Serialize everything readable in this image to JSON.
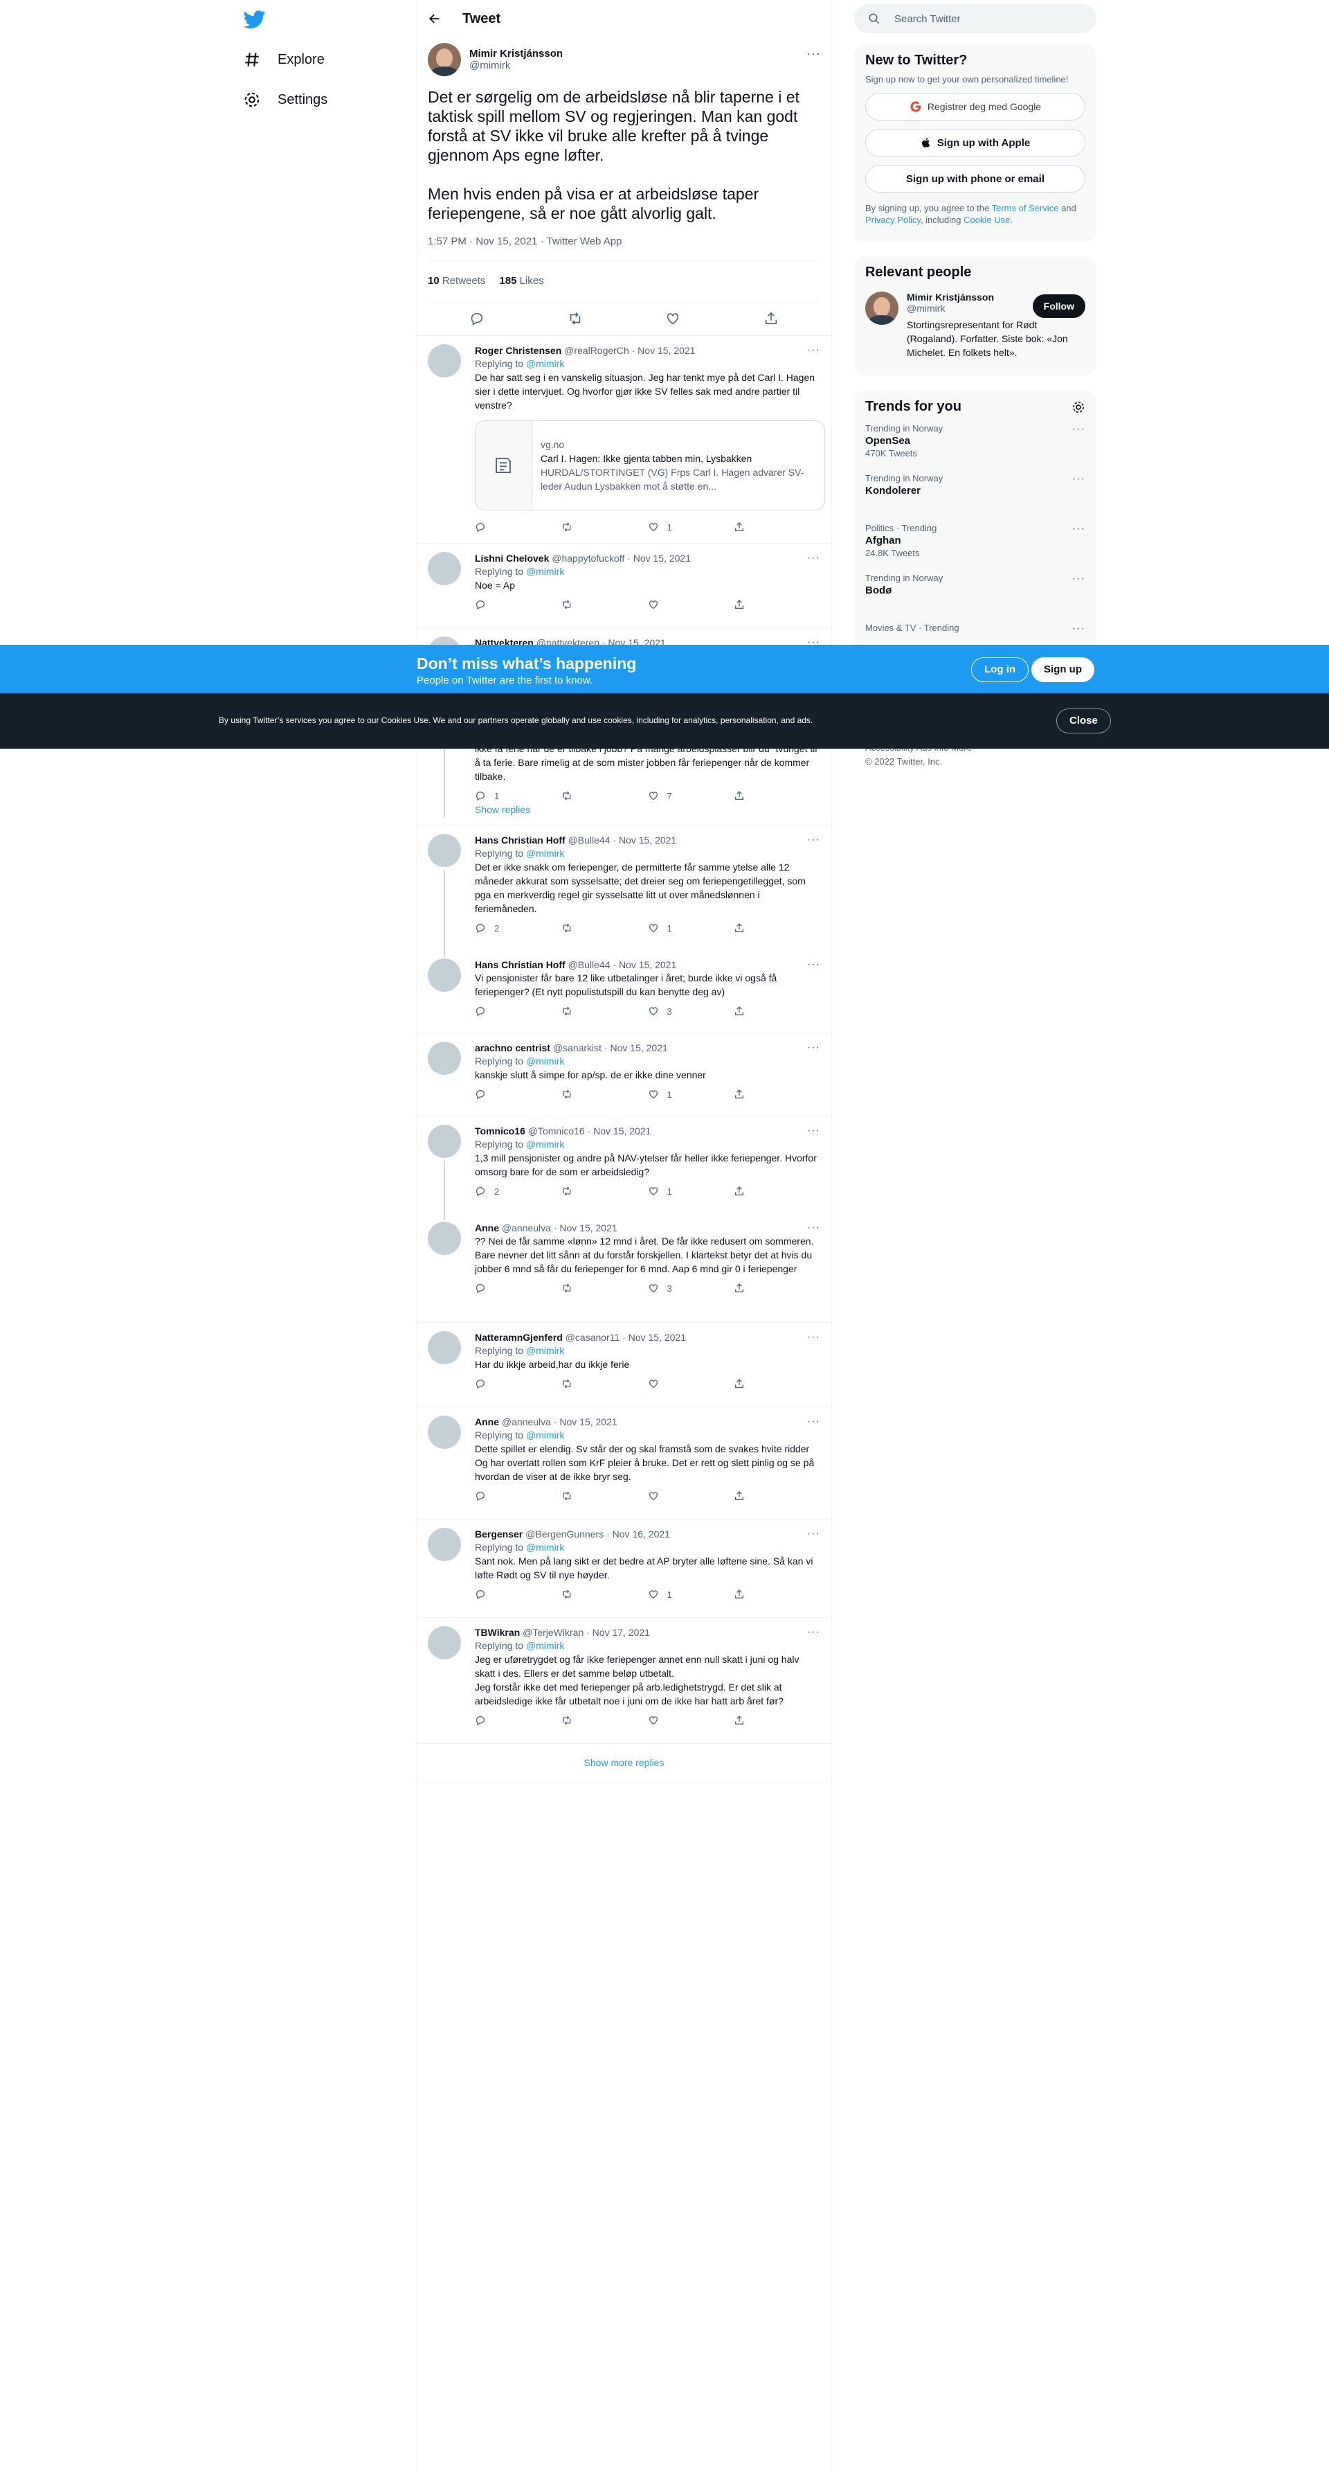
{
  "nav": {
    "explore": "Explore",
    "settings": "Settings"
  },
  "header": {
    "title": "Tweet"
  },
  "main_tweet": {
    "name": "Mimir Kristjánsson",
    "handle": "@mimirk",
    "text": "Det er sørgelig om de arbeidsløse nå blir taperne i et taktisk spill mellom SV og regjeringen. Man kan godt forstå at SV ikke vil bruke alle krefter på å tvinge gjennom Aps egne løfter.\n\nMen hvis enden på visa er at arbeidsløse taper feriepengene, så er noe gått alvorlig galt.",
    "meta": "1:57 PM · Nov 15, 2021 · Twitter Web App",
    "retweets_count": "10",
    "retweets_label": "Retweets",
    "likes_count": "185",
    "likes_label": "Likes"
  },
  "replies": [
    {
      "name": "Roger Christensen",
      "handle": "@realRogerCh",
      "date": "· Nov 15, 2021",
      "replying": "Replying to",
      "to": "@mimirk",
      "text": "De har satt seg i en vanskelig situasjon. Jeg har tenkt mye på det Carl I. Hagen sier i dette intervjuet. Og hvorfor gjør ikke SV felles sak med andre partier til venstre?",
      "card": {
        "domain": "vg.no",
        "title": "Carl I. Hagen: Ikke gjenta tabben min, Lysbakken",
        "desc": "HURDAL/STORTINGET (VG) Frps Carl I. Hagen advarer SV-leder Audun Lysbakken mot å støtte en..."
      },
      "replies": "",
      "retweets": "",
      "likes": "1"
    },
    {
      "name": "Lishni Chelovek",
      "handle": "@happytofuckoff",
      "date": "· Nov 15, 2021",
      "replying": "Replying to",
      "to": "@mimirk",
      "text": "Noe = Ap",
      "replies": "",
      "retweets": "",
      "likes": ""
    },
    {
      "name": "Nattvekteren",
      "handle": "@nattvekteren",
      "date": "· Nov 15, 2021"
    },
    {
      "text": "ikke få ferie når de er tilbake i jobb? På mange arbeidsplasser blir du \"tvunget til å ta ferie. Bare rimelig at de som mister jobben får feriepenger når de kommer tilbake.",
      "replies": "1",
      "retweets": "",
      "likes": "7",
      "show_replies": "Show replies"
    },
    {
      "name": "Hans Christian Hoff",
      "handle": "@Bulle44",
      "date": "· Nov 15, 2021",
      "replying": "Replying to",
      "to": "@mimirk",
      "text": "Det er ikke snakk om feriepenger, de permitterte får samme ytelse alle 12 måneder akkurat som sysselsatte; det dreier seg om feriepengetillegget, som pga en merkverdig regel gir sysselsatte  litt ut over månedslønnen i feriemåneden.",
      "replies": "2",
      "retweets": "",
      "likes": "1"
    },
    {
      "name": "Hans Christian Hoff",
      "handle": "@Bulle44",
      "date": "· Nov 15, 2021",
      "text": "Vi pensjonister får bare 12 like utbetalinger i året; burde ikke vi også få feriepenger?  (Et nytt populistutspill du kan benytte deg av)",
      "replies": "",
      "retweets": "",
      "likes": "3"
    },
    {
      "name": "arachno centrist",
      "handle": "@sanarkist",
      "date": "· Nov 15, 2021",
      "replying": "Replying to",
      "to": "@mimirk",
      "text": "kanskje slutt å simpe for ap/sp. de er ikke dine venner",
      "replies": "",
      "retweets": "",
      "likes": "1"
    },
    {
      "name": "Tomnico16",
      "handle": "@Tomnico16",
      "date": "· Nov 15, 2021",
      "replying": "Replying to",
      "to": "@mimirk",
      "text": "1,3 mill pensjonister og andre på NAV-ytelser får heller ikke feriepenger. Hvorfor omsorg  bare for de som er arbeidsledig?",
      "replies": "2",
      "retweets": "",
      "likes": "1"
    },
    {
      "name": "Anne",
      "handle": "@anneulva",
      "date": "· Nov 15, 2021",
      "text": "?? Nei de får samme «lønn» 12 mnd i året. De får ikke redusert om sommeren. Bare nevner det litt sånn at du forstår forskjellen. I klartekst betyr det at hvis du jobber 6 mnd så får du feriepenger for 6 mnd. Aap 6 mnd gir 0 i feriepenger",
      "replies": "",
      "retweets": "",
      "likes": "3"
    },
    {
      "name": "NatteramnGjenferd",
      "handle": "@casanor11",
      "date": "· Nov 15, 2021",
      "replying": "Replying to",
      "to": "@mimirk",
      "text": "Har du ikkje arbeid,har du ikkje ferie",
      "replies": "",
      "retweets": "",
      "likes": ""
    },
    {
      "name": "Anne",
      "handle": "@anneulva",
      "date": "· Nov 15, 2021",
      "replying": "Replying to",
      "to": "@mimirk",
      "text": "Dette spillet er elendig. Sv står der og skal framstå som de svakes hvite ridder Og har overtatt rollen som KrF pleier å bruke. Det er rett og slett pinlig og se på hvordan de viser at de ikke bryr seg.",
      "replies": "",
      "retweets": "",
      "likes": ""
    },
    {
      "name": "Bergenser",
      "handle": "@BergenGunners",
      "date": "· Nov 16, 2021",
      "replying": "Replying to",
      "to": "@mimirk",
      "text": "Sant nok. Men på lang sikt er det bedre at AP bryter alle løftene sine. Så kan vi løfte Rødt og SV til nye høyder.",
      "replies": "",
      "retweets": "",
      "likes": "1"
    },
    {
      "name": "TBWikran",
      "handle": "@TerjeWikran",
      "date": "· Nov 17, 2021",
      "replying": "Replying to",
      "to": "@mimirk",
      "text": "Jeg er uføretrygdet og får ikke feriepenger annet enn null skatt i juni og halv skatt i des. Ellers er det samme beløp utbetalt.\nJeg forstår ikke det med feriepenger på arb.ledighetstrygd. Er det slik at arbeidsledige ikke får utbetalt noe i juni om de ikke har hatt arb året før?",
      "replies": "",
      "retweets": "",
      "likes": ""
    }
  ],
  "show_more_replies": "Show more replies",
  "search": {
    "placeholder": "Search Twitter"
  },
  "new_to_twitter": {
    "title": "New to Twitter?",
    "sub": "Sign up now to get your own personalized timeline!",
    "google": "Registrer deg med Google",
    "apple": "Sign up with Apple",
    "phone": "Sign up with phone or email",
    "terms_a": "By signing up, you agree to the",
    "terms_tos": "Terms of Service",
    "terms_and": "and",
    "terms_pp": "Privacy Policy",
    "terms_incl": ", including",
    "terms_cookie": "Cookie Use."
  },
  "relevant": {
    "title": "Relevant people",
    "name": "Mimir Kristjánsson",
    "handle": "@mimirk",
    "follow": "Follow",
    "bio": "Stortingsrepresentant for Rødt (Rogaland). Forfatter. Siste bok: «Jon Michelet. En folkets helt»."
  },
  "trends": {
    "title": "Trends for you",
    "items": [
      {
        "meta": "Trending in Norway",
        "name": "OpenSea",
        "count": "470K Tweets"
      },
      {
        "meta": "Trending in Norway",
        "name": "Kondolerer",
        "count": ""
      },
      {
        "meta": "Politics · Trending",
        "name": "Afghan",
        "count": "24.8K Tweets"
      },
      {
        "meta": "Trending in Norway",
        "name": "Bodø",
        "count": ""
      },
      {
        "meta": "Movies & TV · Trending",
        "name": "",
        "count": ""
      }
    ]
  },
  "footer": {
    "line1": "Accessibility   Ads info   More ···",
    "line2": "© 2022 Twitter, Inc."
  },
  "banner": {
    "title": "Don’t miss what’s happening",
    "sub": "People on Twitter are the first to know.",
    "login": "Log in",
    "signup": "Sign up"
  },
  "cookie": {
    "text": "By using Twitter’s services you agree to our Cookies Use. We and our partners operate globally and use cookies, including for analytics, personalisation, and ads.",
    "close": "Close"
  },
  "colors": {
    "brand": "#1d9bf0",
    "text": "#0f1419",
    "muted": "#536471",
    "cookie_bg": "#15202b"
  }
}
